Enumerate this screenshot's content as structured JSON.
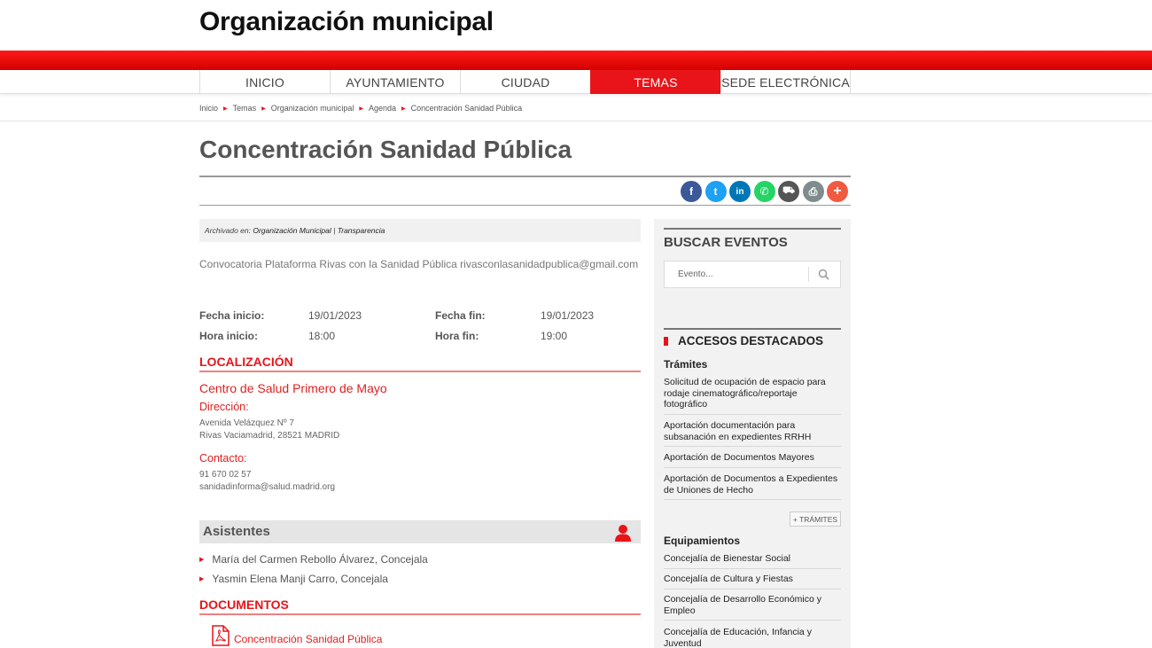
{
  "site": {
    "title": "Organización municipal"
  },
  "nav": [
    {
      "label": "INICIO",
      "active": false
    },
    {
      "label": "AYUNTAMIENTO",
      "active": false
    },
    {
      "label": "CIUDAD",
      "active": false
    },
    {
      "label": "TEMAS",
      "active": true
    },
    {
      "label": "SEDE ELECTRÓNICA",
      "active": false
    }
  ],
  "breadcrumb": [
    "Inicio",
    "Temas",
    "Organización municipal",
    "Agenda",
    "Concentración Sanidad Pública"
  ],
  "page": {
    "title": "Concentración Sanidad Pública"
  },
  "share": [
    {
      "icon": "facebook-icon",
      "glyph": "f",
      "color": "#3b5998"
    },
    {
      "icon": "twitter-icon",
      "glyph": "t",
      "color": "#1da1f2"
    },
    {
      "icon": "linkedin-icon",
      "glyph": "in",
      "color": "#0077b5"
    },
    {
      "icon": "whatsapp-icon",
      "glyph": "✆",
      "color": "#25d366"
    },
    {
      "icon": "car-icon",
      "glyph": "⛟",
      "color": "#555555"
    },
    {
      "icon": "print-icon",
      "glyph": "⎙",
      "color": "#7f8c8d"
    },
    {
      "icon": "plus-icon",
      "glyph": "+",
      "color": "#f05a40"
    }
  ],
  "archived": {
    "prefix": "Archivado en:",
    "cat1": "Organización Municipal",
    "sep": "|",
    "cat2": "Transparencia"
  },
  "description": "Convocatoria Plataforma Rivas con la Sanidad Pública rivasconlasanidadpublica@gmail.com",
  "dates": {
    "start_date_label": "Fecha inicio:",
    "start_date": "19/01/2023",
    "end_date_label": "Fecha fin:",
    "end_date": "19/01/2023",
    "start_time_label": "Hora inicio:",
    "start_time": "18:00",
    "end_time_label": "Hora fin:",
    "end_time": "19:00"
  },
  "location": {
    "heading": "LOCALIZACIÓN",
    "name": "Centro de Salud Primero de Mayo",
    "address_label": "Dirección:",
    "address_line1": "Avenida Velázquez Nº 7",
    "address_line2": "Rivas Vaciamadrid, 28521 MADRID",
    "contact_label": "Contacto:",
    "phone": "91 670 02 57",
    "email": "sanidadinforma@salud.madrid.org"
  },
  "attendees": {
    "heading": "Asistentes",
    "items": [
      "María del Carmen Rebollo Álvarez, Concejala",
      "Yasmin Elena Manji Carro, Concejala"
    ]
  },
  "documents": {
    "heading": "DOCUMENTOS",
    "items": [
      "Concentración Sanidad Pública"
    ]
  },
  "sidebar": {
    "search_heading": "BUSCAR EVENTOS",
    "search_placeholder": "Evento...",
    "featured_heading": "ACCESOS DESTACADOS",
    "tramites_heading": "Trámites",
    "tramites": [
      "Solicitud de ocupación de espacio para rodaje cinematográfico/reportaje fotográfico",
      "Aportación documentación para subsanación en expedientes RRHH",
      "Aportación de Documentos Mayores",
      "Aportación de Documentos a Expedientes de Uniones de Hecho"
    ],
    "more_tramites": "+ TRÁMITES",
    "equip_heading": "Equipamientos",
    "equipamientos": [
      "Concejalía de Bienestar Social",
      "Concejalía de Cultura y Fiestas",
      "Concejalía de Desarrollo Económico y Empleo",
      "Concejalía de Educación, Infancia y Juventud"
    ]
  },
  "colors": {
    "accent": "#e8141a",
    "share_plus": "#f05a40"
  }
}
